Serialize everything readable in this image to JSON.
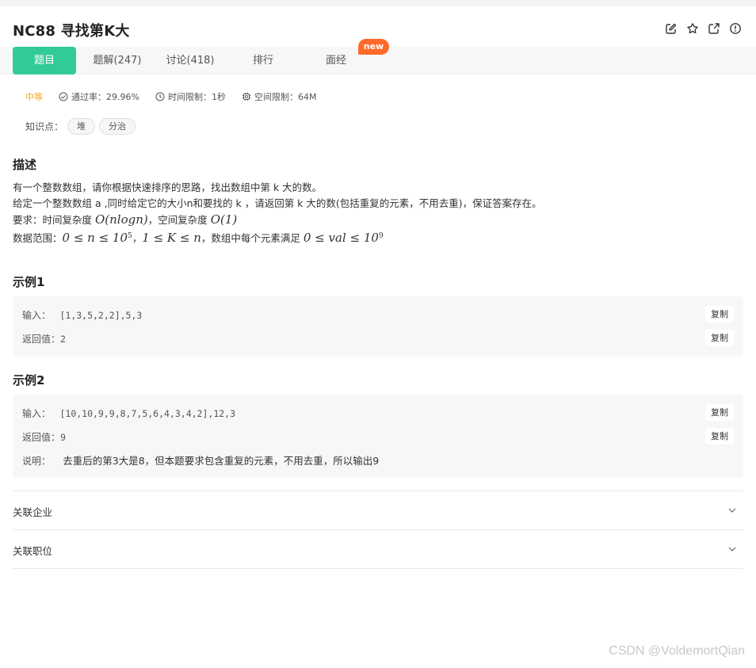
{
  "header": {
    "title": "NC88  寻找第K大",
    "icons": [
      "edit-icon",
      "star-icon",
      "share-icon",
      "report-icon"
    ]
  },
  "tabs": [
    {
      "label": "题目",
      "active": true
    },
    {
      "label": "题解(247)",
      "active": false
    },
    {
      "label": "讨论(418)",
      "active": false
    },
    {
      "label": "排行",
      "active": false
    },
    {
      "label": "面经",
      "active": false
    }
  ],
  "badge": {
    "new_label": "new"
  },
  "meta": {
    "difficulty": "中等",
    "pass_rate": "通过率：29.96%",
    "time_limit": "时间限制：1秒",
    "space_limit": "空间限制：64M"
  },
  "knowledge": {
    "label": "知识点：",
    "tags": [
      "堆",
      "分治"
    ]
  },
  "description": {
    "heading": "描述",
    "line1": "有一个整数数组，请你根据快速排序的思路，找出数组中第 k 大的数。",
    "line2": "给定一个整数数组 a ,同时给定它的大小n和要找的 k ，请返回第 k 大的数(包括重复的元素，不用去重)，保证答案存在。",
    "line3_prefix": "要求：时间复杂度 ",
    "line3_math1": "O(nlogn)",
    "line3_mid": "，空间复杂度 ",
    "line3_math2": "O(1)",
    "line4_prefix": "数据范围：",
    "line4_math1": "0 ≤ n ≤ 10",
    "line4_sup1": "5",
    "line4_sep": "，",
    "line4_math2": "1 ≤ K ≤ n",
    "line4_mid": "，数组中每个元素满足 ",
    "line4_math3": "0 ≤ val ≤ 10",
    "line4_sup2": "9"
  },
  "example1": {
    "heading": "示例1",
    "input_label": "输入：",
    "input_value": "[1,3,5,2,2],5,3",
    "output_label": "返回值：",
    "output_value": "2",
    "copy_label": "复制"
  },
  "example2": {
    "heading": "示例2",
    "input_label": "输入：",
    "input_value": "[10,10,9,9,8,7,5,6,4,3,4,2],12,3",
    "output_label": "返回值：",
    "output_value": "9",
    "explain_label": "说明：",
    "explain_value": "去重后的第3大是8，但本题要求包含重复的元素，不用去重，所以输出9",
    "copy_label": "复制"
  },
  "sections": [
    {
      "label": "关联企业"
    },
    {
      "label": "关联职位"
    }
  ],
  "watermark": "CSDN @VoldemortQian",
  "colors": {
    "accent": "#32ca99",
    "badge": "#ff6a2a",
    "difficulty": "#f5a623"
  }
}
